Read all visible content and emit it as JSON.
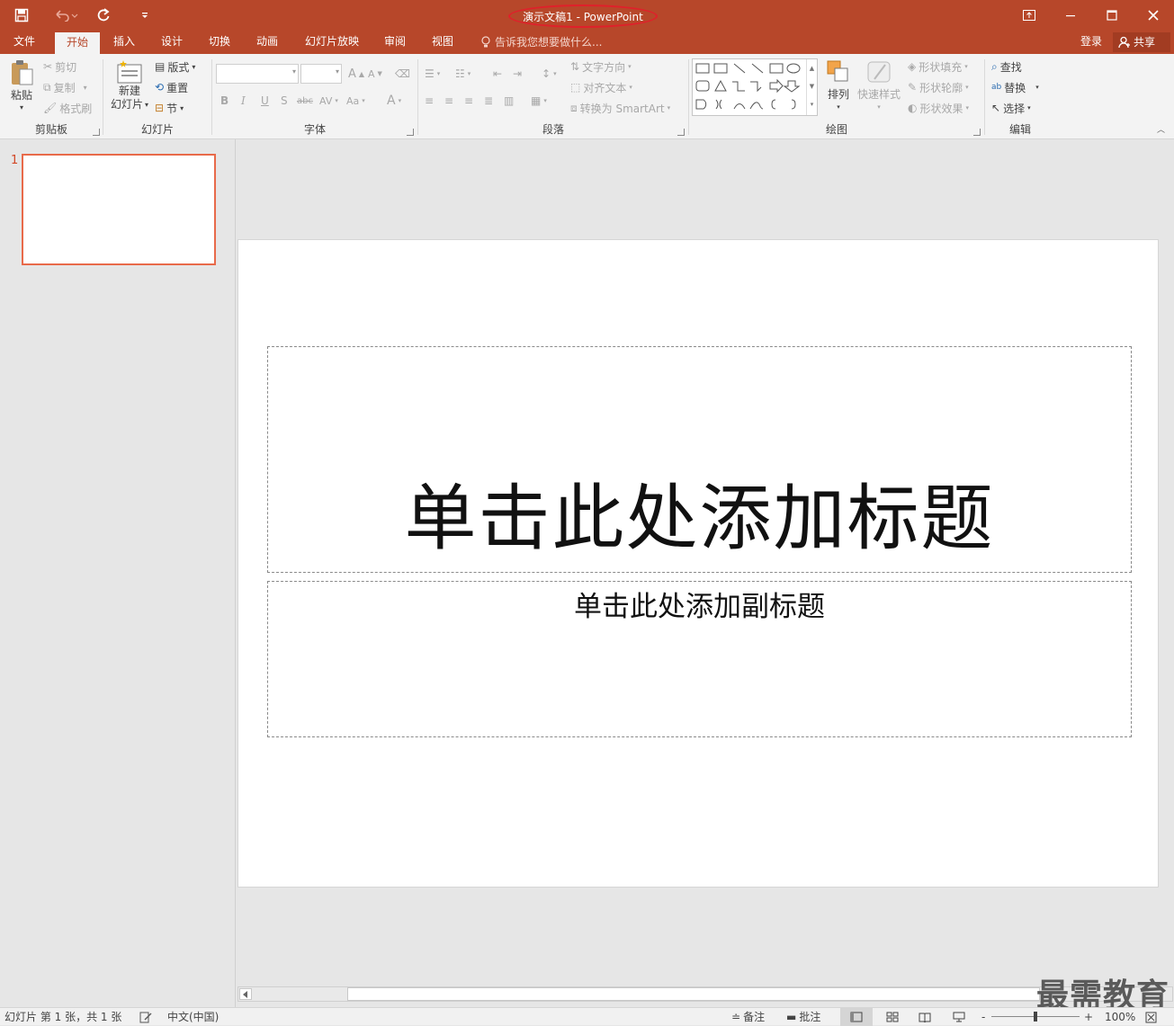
{
  "window": {
    "title": "演示文稿1 - PowerPoint",
    "accent": "#b7472a"
  },
  "quick_access": [
    "save-icon",
    "undo-icon",
    "redo-icon",
    "customize-icon"
  ],
  "tabs": [
    {
      "label": "文件"
    },
    {
      "label": "开始",
      "active": true
    },
    {
      "label": "插入"
    },
    {
      "label": "设计"
    },
    {
      "label": "切换"
    },
    {
      "label": "动画"
    },
    {
      "label": "幻灯片放映"
    },
    {
      "label": "审阅"
    },
    {
      "label": "视图"
    }
  ],
  "tell_me": "告诉我您想要做什么...",
  "account": {
    "login": "登录",
    "share": "共享"
  },
  "ribbon": {
    "clipboard": {
      "label": "剪贴板",
      "paste": "粘贴",
      "cut": "剪切",
      "copy": "复制",
      "format_painter": "格式刷"
    },
    "slides": {
      "label": "幻灯片",
      "new_slide_1": "新建",
      "new_slide_2": "幻灯片",
      "layout": "版式",
      "reset": "重置",
      "section": "节"
    },
    "font": {
      "label": "字体",
      "font_name": "",
      "font_size": ""
    },
    "paragraph": {
      "label": "段落",
      "text_direction": "文字方向",
      "align_text": "对齐文本",
      "smartart": "转换为 SmartArt"
    },
    "drawing": {
      "label": "绘图",
      "arrange": "排列",
      "quick_styles": "快速样式",
      "shape_fill": "形状填充",
      "shape_outline": "形状轮廓",
      "shape_effects": "形状效果"
    },
    "editing": {
      "label": "编辑",
      "find": "查找",
      "replace": "替换",
      "select": "选择"
    }
  },
  "thumbnails": [
    {
      "number": "1"
    }
  ],
  "slide": {
    "title_placeholder": "单击此处添加标题",
    "subtitle_placeholder": "单击此处添加副标题"
  },
  "statusbar": {
    "slide_info": "幻灯片 第 1 张，共 1 张",
    "language": "中文(中国)",
    "notes": "备注",
    "comments": "批注",
    "zoom_minus": "-",
    "zoom_plus": "+",
    "zoom": "100%"
  },
  "watermark": "最需教育"
}
